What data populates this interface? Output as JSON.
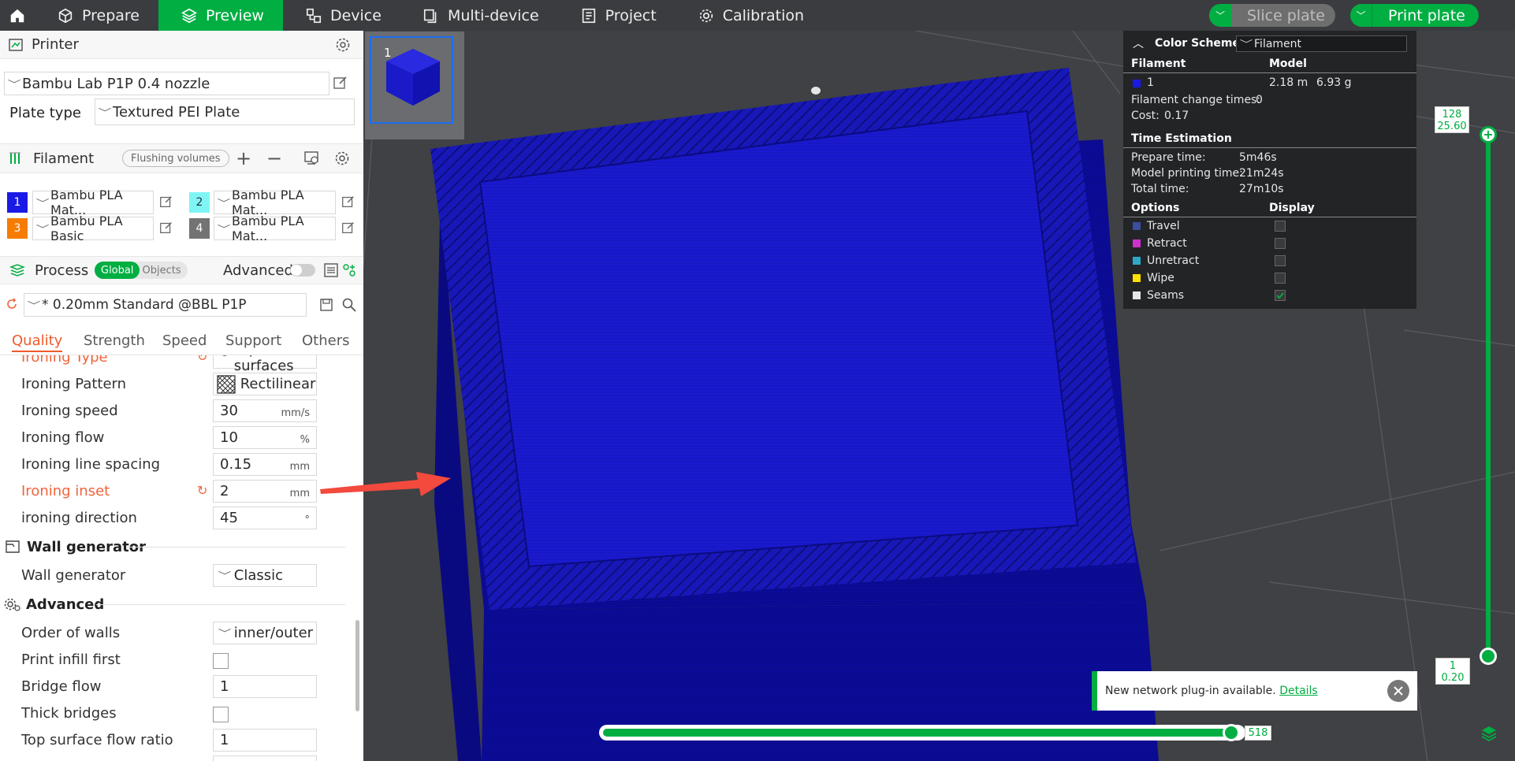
{
  "nav": {
    "tabs": [
      "Prepare",
      "Preview",
      "Device",
      "Multi-device",
      "Project",
      "Calibration"
    ],
    "active": "Preview",
    "slice_label": "Slice plate",
    "print_label": "Print plate"
  },
  "printer": {
    "section_title": "Printer",
    "selected": "Bambu Lab P1P 0.4 nozzle",
    "plate_type_label": "Plate type",
    "plate_type_value": "Textured PEI Plate"
  },
  "filament": {
    "section_title": "Filament",
    "flushing_label": "Flushing volumes",
    "items": [
      {
        "num": "1",
        "color": "#1a1ae6",
        "name": "Bambu PLA Mat..."
      },
      {
        "num": "2",
        "color": "#7ff5f5",
        "name": "Bambu PLA Mat..."
      },
      {
        "num": "3",
        "color": "#f57c00",
        "name": "Bambu PLA Basic"
      },
      {
        "num": "4",
        "color": "#737373",
        "name": "Bambu PLA Mat..."
      }
    ]
  },
  "process": {
    "section_title": "Process",
    "global_label": "Global",
    "objects_label": "Objects",
    "advanced_label": "Advanced",
    "preset": "* 0.20mm Standard @BBL P1P",
    "tabs": [
      "Quality",
      "Strength",
      "Speed",
      "Support",
      "Others"
    ],
    "active_tab": "Quality"
  },
  "params": {
    "ironing_type_label": "Ironing Type",
    "ironing_type_value": "Top surfaces",
    "ironing_pattern_label": "Ironing Pattern",
    "ironing_pattern_value": "Rectilinear",
    "ironing_speed_label": "Ironing speed",
    "ironing_speed_value": "30",
    "ironing_speed_unit": "mm/s",
    "ironing_flow_label": "Ironing flow",
    "ironing_flow_value": "10",
    "ironing_flow_unit": "%",
    "ironing_spacing_label": "Ironing line spacing",
    "ironing_spacing_value": "0.15",
    "ironing_spacing_unit": "mm",
    "ironing_inset_label": "Ironing inset",
    "ironing_inset_value": "2",
    "ironing_inset_unit": "mm",
    "ironing_direction_label": "ironing direction",
    "ironing_direction_value": "45",
    "ironing_direction_unit": "°",
    "wall_group": "Wall generator",
    "wall_generator_label": "Wall generator",
    "wall_generator_value": "Classic",
    "advanced_group": "Advanced",
    "order_walls_label": "Order of walls",
    "order_walls_value": "inner/outer",
    "infill_first_label": "Print infill first",
    "bridge_flow_label": "Bridge flow",
    "bridge_flow_value": "1",
    "thick_bridges_label": "Thick bridges",
    "top_flow_label": "Top surface flow ratio",
    "top_flow_value": "1"
  },
  "stats": {
    "color_scheme_label": "Color Scheme",
    "color_scheme_value": "Filament",
    "col_filament": "Filament",
    "col_model": "Model",
    "row_num": "1",
    "row_length": "2.18 m",
    "row_weight": "6.93 g",
    "filament_change": "Filament change times:",
    "filament_change_value": "0",
    "cost": "Cost:",
    "cost_value": "0.17",
    "time_title": "Time Estimation",
    "prepare_time_label": "Prepare time:",
    "prepare_time": "5m46s",
    "model_time_label": "Model printing time:",
    "model_time": "21m24s",
    "total_time_label": "Total time:",
    "total_time": "27m10s",
    "options_label": "Options",
    "display_label": "Display",
    "options": [
      {
        "name": "Travel",
        "color": "#3a4fa0",
        "checked": false
      },
      {
        "name": "Retract",
        "color": "#d02fd0",
        "checked": false
      },
      {
        "name": "Unretract",
        "color": "#2fa8c8",
        "checked": false
      },
      {
        "name": "Wipe",
        "color": "#ffe000",
        "checked": false
      },
      {
        "name": "Seams",
        "color": "#e6e6e6",
        "checked": true
      }
    ]
  },
  "plate_thumb_num": "1",
  "vslider": {
    "top_layer": "128",
    "top_height": "25.60",
    "bottom_layer": "1",
    "bottom_height": "0.20"
  },
  "hslider": {
    "value": "518"
  },
  "notification": {
    "text": "New network plug-in available.",
    "link": "Details"
  },
  "colors": {
    "accent": "#00ae42",
    "model": "#1a1ab0",
    "modified": "#f0643c"
  }
}
